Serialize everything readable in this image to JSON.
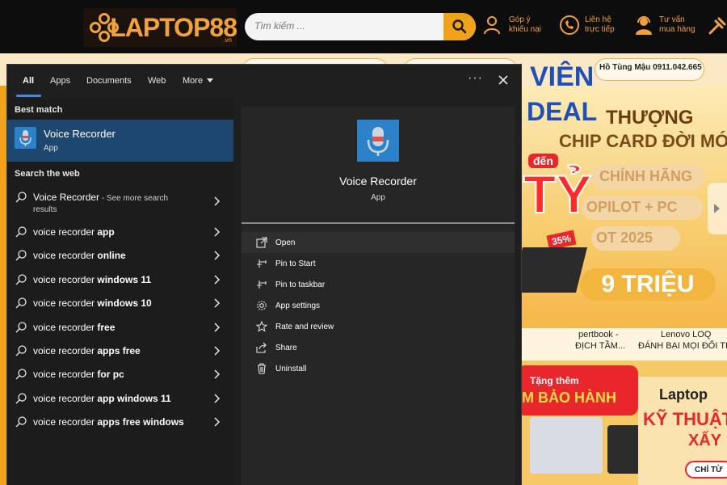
{
  "site": {
    "logo_text": "LAPTOP88",
    "logo_suffix": ".vn",
    "search_placeholder": "Tìm kiếm ...",
    "links": [
      {
        "line1": "Góp ý",
        "line2": "khiếu nại"
      },
      {
        "line1": "Liên hệ",
        "line2": "trực tiếp"
      },
      {
        "line1": "Tư vấn",
        "line2": "mua hàng"
      }
    ],
    "address": "Hồ Tùng Mậu  0911.042.665",
    "banner": {
      "line1": "VIÊN",
      "line2": "DEAL",
      "line3": "THƯỢNG",
      "line4": "CHIP CARD ĐỜI MỚI",
      "line5": "đến",
      "line6": "TỶ",
      "line7": "CHÍNH HÃNG",
      "line8": "OPILOT + PC",
      "line9": "OT 2025",
      "line10": "35%",
      "line11": "9 TRIỆU"
    },
    "strip": {
      "item1_title": "pertbook -",
      "item1_sub": "ĐỊCH TẦM...",
      "item2_title": "Lenovo LOQ",
      "item2_sub": "ĐÁNH BẠI MỌI ĐỐI TH"
    },
    "promo": {
      "red_line1": "Tặng thêm",
      "red_line2": "M BẢO HÀNH",
      "right_line1": "Laptop",
      "right_line2": "KỸ THUẬT",
      "right_line3": "XẤY",
      "right_btn": "CHỈ TỪ"
    }
  },
  "search": {
    "tabs": [
      {
        "label": "All",
        "active": true
      },
      {
        "label": "Apps"
      },
      {
        "label": "Documents"
      },
      {
        "label": "Web"
      },
      {
        "label": "More"
      }
    ],
    "dots_label": "···",
    "best_match_header": "Best match",
    "best_match": {
      "name": "Voice Recorder",
      "type": "App"
    },
    "web_header": "Search the web",
    "web_first": {
      "text": "Voice Recorder",
      "see_more": " - See more search",
      "results": "results"
    },
    "suggestions": [
      {
        "prefix": "voice recorder ",
        "bold": "app"
      },
      {
        "prefix": "voice recorder ",
        "bold": "online"
      },
      {
        "prefix": "voice recorder ",
        "bold": "windows 11"
      },
      {
        "prefix": "voice recorder ",
        "bold": "windows 10"
      },
      {
        "prefix": "voice recorder ",
        "bold": "free"
      },
      {
        "prefix": "voice recorder ",
        "bold": "apps free"
      },
      {
        "prefix": "voice recorder ",
        "bold": "for pc"
      },
      {
        "prefix": "voice recorder ",
        "bold": "app windows 11"
      },
      {
        "prefix": "voice recorder ",
        "bold": "apps free windows"
      }
    ],
    "preview": {
      "name": "Voice Recorder",
      "type": "App",
      "actions": [
        {
          "label": "Open",
          "icon": "open-icon"
        },
        {
          "label": "Pin to Start",
          "icon": "pin-icon"
        },
        {
          "label": "Pin to taskbar",
          "icon": "pin-icon"
        },
        {
          "label": "App settings",
          "icon": "gear-icon"
        },
        {
          "label": "Rate and review",
          "icon": "star-icon"
        },
        {
          "label": "Share",
          "icon": "share-icon"
        },
        {
          "label": "Uninstall",
          "icon": "trash-icon"
        }
      ]
    }
  },
  "colors": {
    "accent": "#3b8eea",
    "selection": "#1e4770",
    "app_icon": "#2b82c9",
    "site_orange": "#f0a21a"
  }
}
